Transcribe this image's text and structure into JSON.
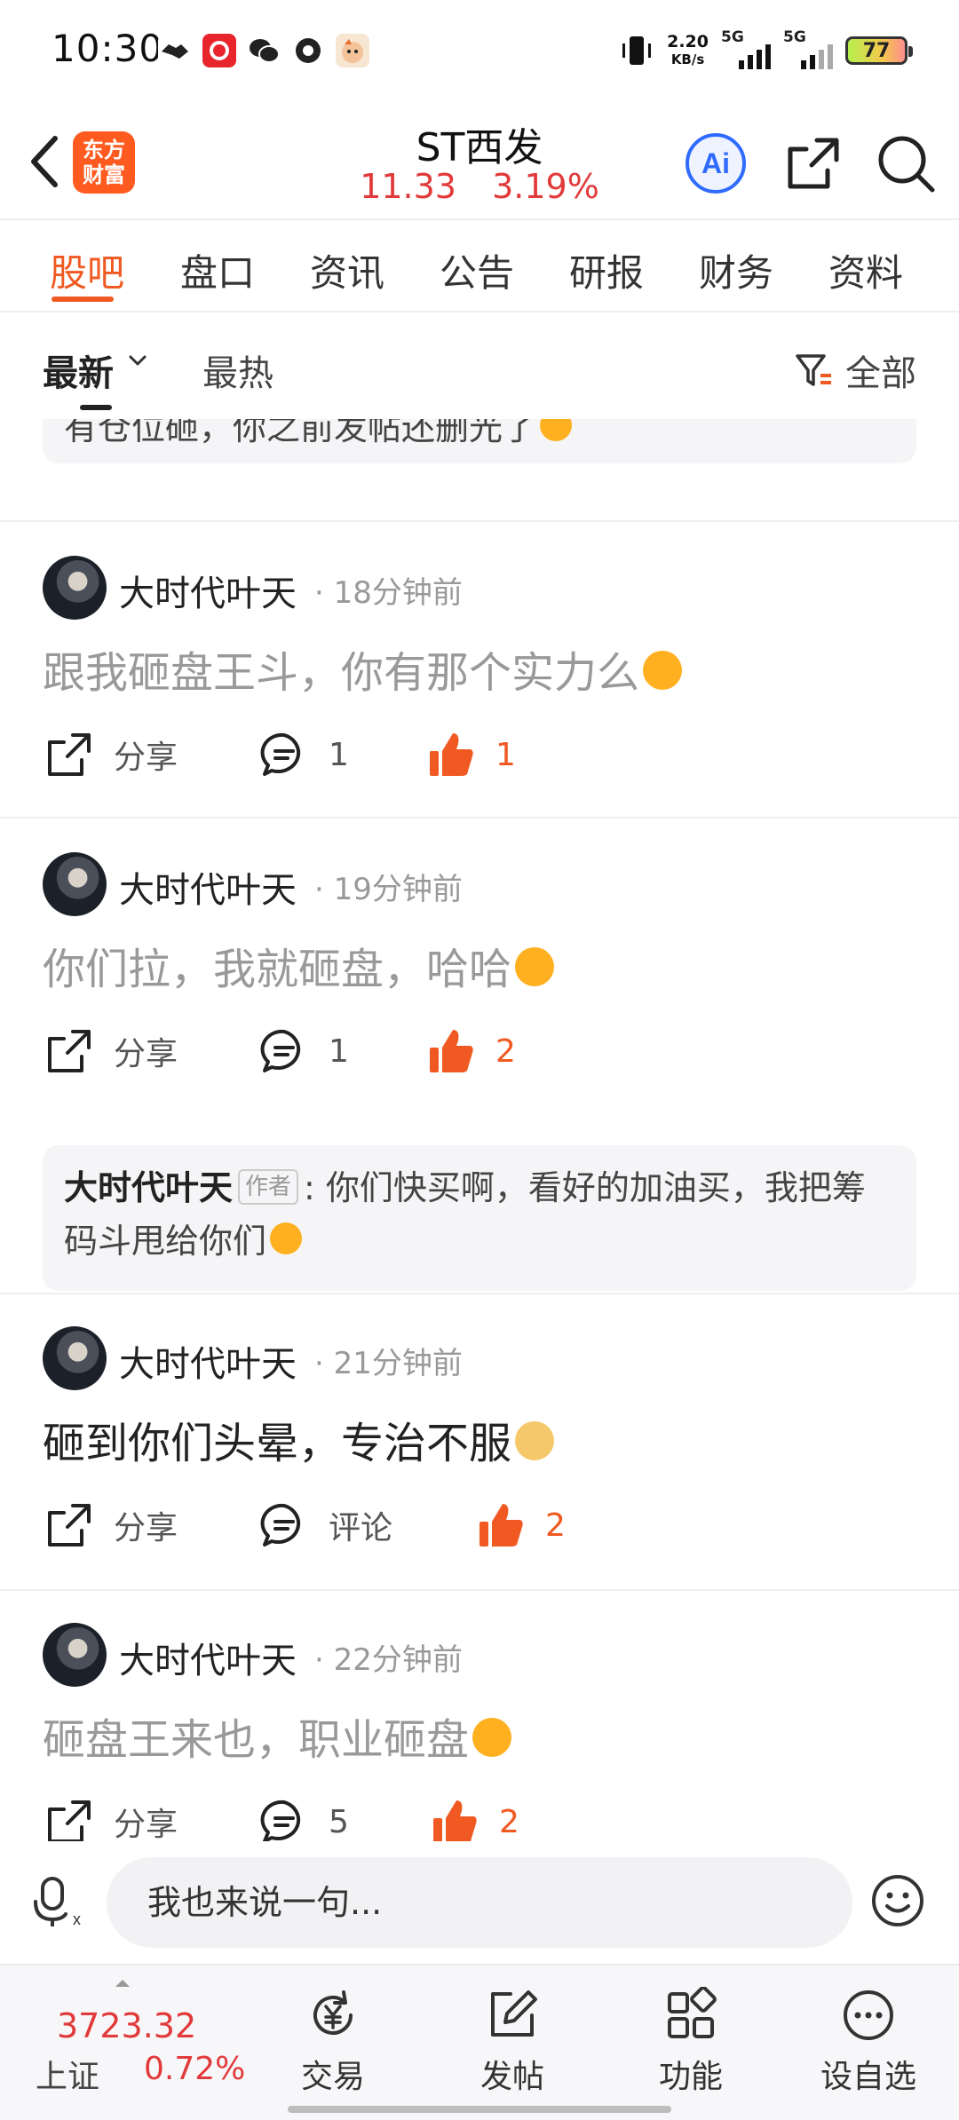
{
  "status_bar": {
    "time": "10:30",
    "net_speed_value": "2.20",
    "net_speed_unit": "KB/s",
    "signal_1": "5G",
    "signal_2": "5G",
    "battery": "77"
  },
  "header": {
    "logo_line1": "东方",
    "logo_line2": "财富",
    "title": "ST西发",
    "price": "11.33",
    "change_pct": "3.19%",
    "ai_label": "Ai"
  },
  "tabs": [
    "股吧",
    "盘口",
    "资讯",
    "公告",
    "研报",
    "财务",
    "资料"
  ],
  "filter": {
    "latest": "最新",
    "hot": "最热",
    "all": "全部"
  },
  "feed": {
    "top_quote": "有仓位砸，你之前发帖还删光了",
    "share_label": "分享",
    "posts": [
      {
        "author": "大时代叶天",
        "time": "· 18分钟前",
        "content": "跟我砸盘王斗，你有那个实力么",
        "comments": "1",
        "likes": "1"
      },
      {
        "author": "大时代叶天",
        "time": "· 19分钟前",
        "content": "你们拉，我就砸盘，哈哈",
        "comments": "1",
        "likes": "2",
        "reply": {
          "name": "大时代叶天",
          "tag": "作者",
          "text": ": 你们快买啊，看好的加油买，我把筹码斗甩给你们"
        }
      },
      {
        "author": "大时代叶天",
        "time": "· 21分钟前",
        "content": "砸到你们头晕，专治不服",
        "comments": "评论",
        "likes": "2"
      },
      {
        "author": "大时代叶天",
        "time": "· 22分钟前",
        "content": "砸盘王来也，职业砸盘",
        "comments": "5",
        "likes": "2"
      }
    ]
  },
  "input": {
    "placeholder": "我也来说一句..."
  },
  "bottom_nav": {
    "index_value": "3723.32",
    "index_name": "上证",
    "index_pct": "0.72%",
    "items": [
      "交易",
      "发帖",
      "功能",
      "设自选"
    ]
  },
  "colors": {
    "accent": "#f05a22",
    "rise": "#e23a3a"
  }
}
